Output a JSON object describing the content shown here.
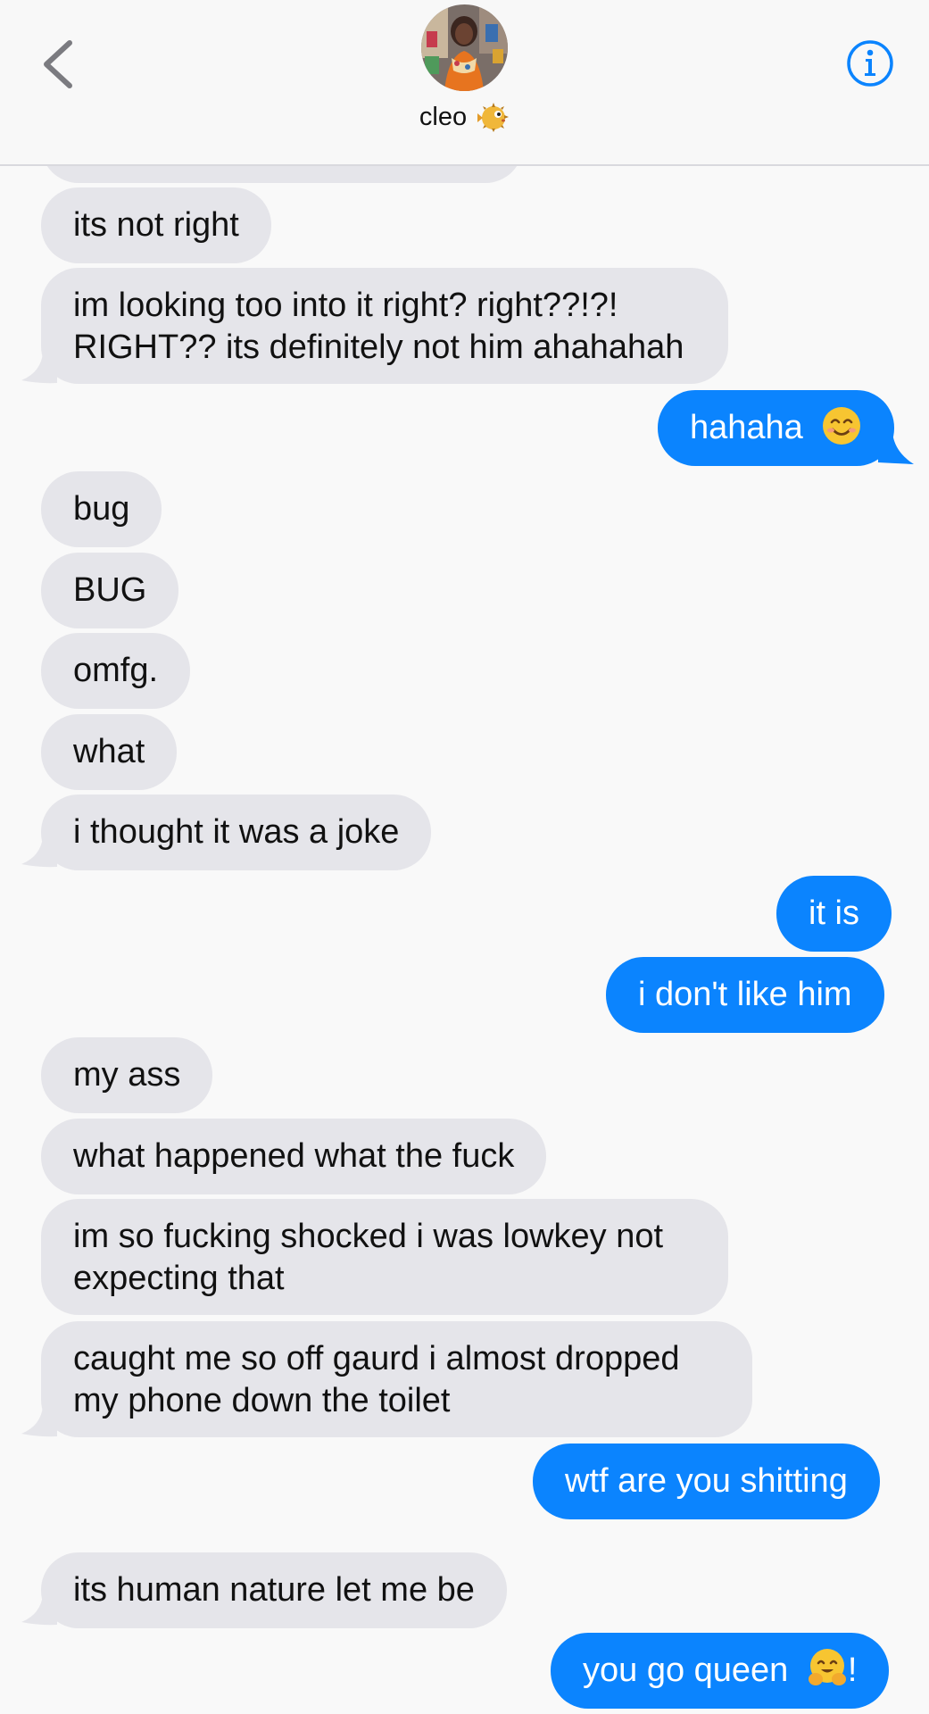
{
  "header": {
    "contact_name": "cleo",
    "contact_name_emoji": "blowfish-icon",
    "back_icon": "chevron-left-icon",
    "info_icon": "info-circle-icon",
    "accent_color": "#0b84fe"
  },
  "colors": {
    "incoming_bubble": "#e5e5ea",
    "outgoing_bubble": "#0b84fe",
    "background": "#f9f9f9"
  },
  "messages": [
    {
      "sender": "them",
      "text": "its not right"
    },
    {
      "sender": "them",
      "line1": "im looking too into it right? right??!?!",
      "line2": "RIGHT?? its definitely not him ahahahah"
    },
    {
      "sender": "me",
      "text": "hahaha",
      "emoji": "smiling-face-icon"
    },
    {
      "sender": "them",
      "text": "bug"
    },
    {
      "sender": "them",
      "text": "BUG"
    },
    {
      "sender": "them",
      "text": "omfg."
    },
    {
      "sender": "them",
      "text": "what"
    },
    {
      "sender": "them",
      "text": "i thought it was a joke"
    },
    {
      "sender": "me",
      "text": "it is"
    },
    {
      "sender": "me",
      "text": "i don't like him"
    },
    {
      "sender": "them",
      "text": "my ass"
    },
    {
      "sender": "them",
      "text": "what happened what the fuck"
    },
    {
      "sender": "them",
      "line1": "im so fucking shocked i was lowkey not",
      "line2": "expecting that"
    },
    {
      "sender": "them",
      "line1": "caught me so off gaurd i almost dropped",
      "line2": "my phone down the toilet"
    },
    {
      "sender": "me",
      "text": "wtf are you shitting"
    },
    {
      "sender": "them",
      "text": "its human nature let me be"
    },
    {
      "sender": "me",
      "text": "you go queen",
      "emoji": "hugging-face-icon",
      "suffix": "!"
    }
  ]
}
